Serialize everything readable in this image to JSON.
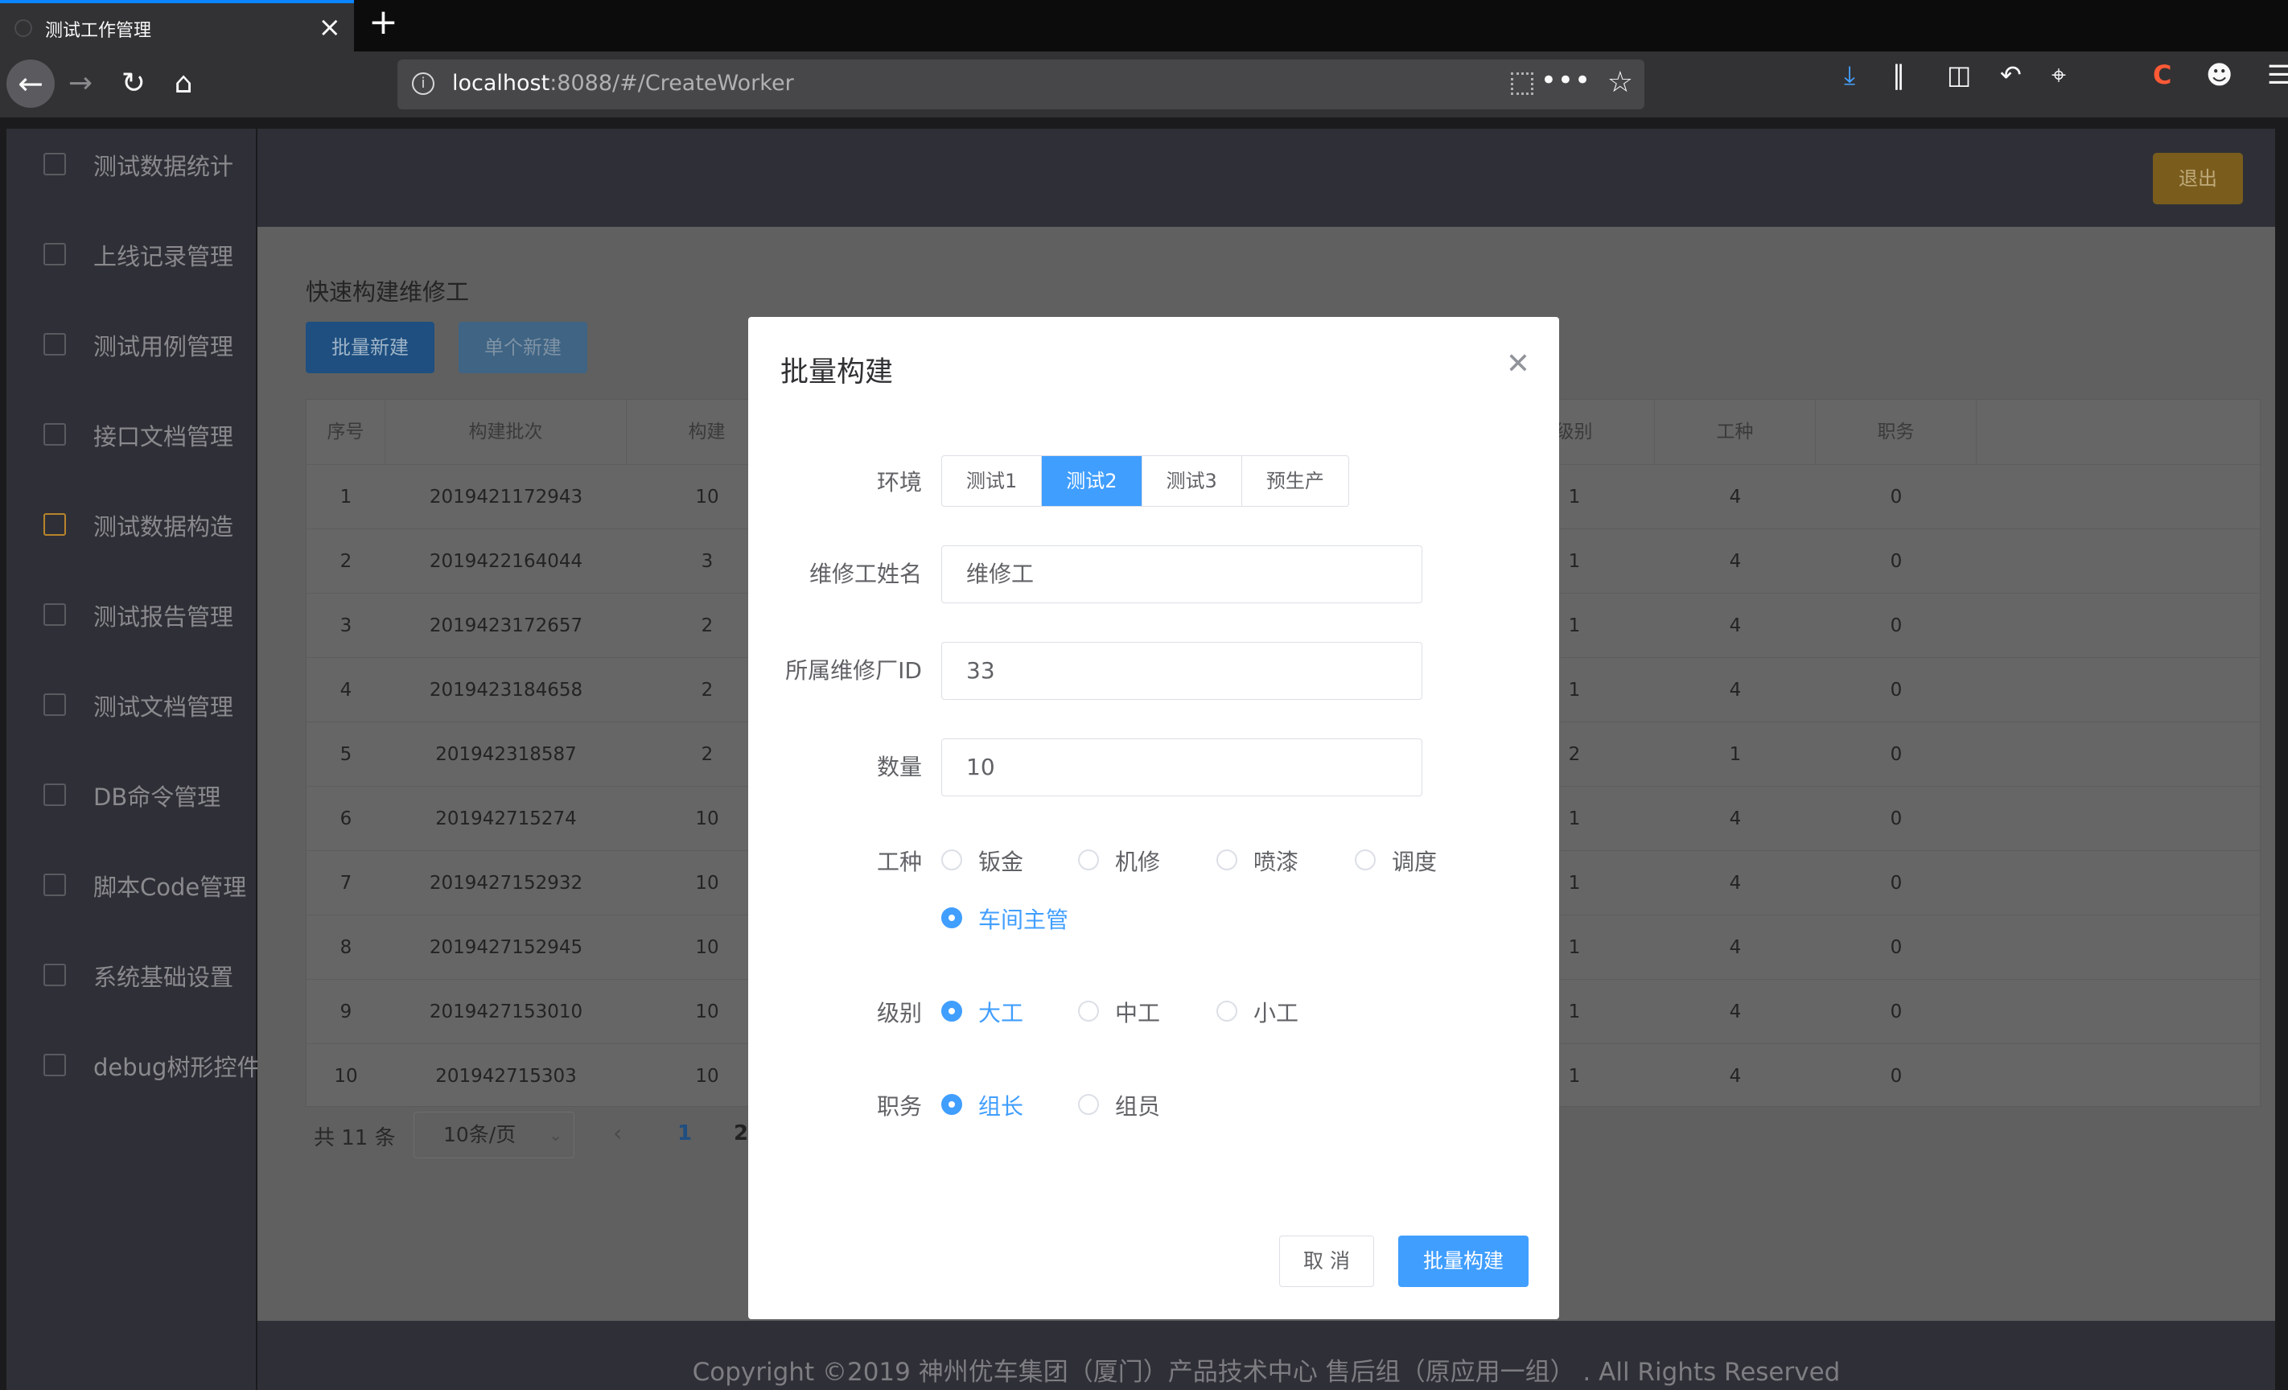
{
  "browser": {
    "tab_title": "测试工作管理",
    "tab_close_icon": "×",
    "new_tab_icon": "+",
    "url_host": "localhost",
    "url_rest": ":8088/#/CreateWorker"
  },
  "sidebar": {
    "items": [
      {
        "label": "测试数据统计",
        "icon": "bar-chart-icon"
      },
      {
        "label": "上线记录管理",
        "icon": "record-icon"
      },
      {
        "label": "测试用例管理",
        "icon": "document-icon"
      },
      {
        "label": "接口文档管理",
        "icon": "api-doc-icon"
      },
      {
        "label": "测试数据构造",
        "icon": "edit-icon"
      },
      {
        "label": "测试报告管理",
        "icon": "report-icon"
      },
      {
        "label": "测试文档管理",
        "icon": "file-check-icon"
      },
      {
        "label": "DB命令管理",
        "icon": "database-icon"
      },
      {
        "label": "脚本Code管理",
        "icon": "code-icon"
      },
      {
        "label": "系统基础设置",
        "icon": "gear-icon"
      },
      {
        "label": "debug树形控件",
        "icon": "tree-doc-icon"
      }
    ]
  },
  "header": {
    "logout_label": "退出"
  },
  "page": {
    "title": "快速构建维修工",
    "batch_new_label": "批量新建",
    "single_new_label": "单个新建"
  },
  "table": {
    "columns": {
      "seq": "序号",
      "batch": "构建批次",
      "build": "构建",
      "level": "级别",
      "type": "工种",
      "duty": "职务"
    },
    "rows": [
      {
        "seq": "1",
        "batch": "2019421172943",
        "build": "10",
        "level": "1",
        "type": "4",
        "duty": "0"
      },
      {
        "seq": "2",
        "batch": "2019422164044",
        "build": "3",
        "level": "1",
        "type": "4",
        "duty": "0"
      },
      {
        "seq": "3",
        "batch": "2019423172657",
        "build": "2",
        "level": "1",
        "type": "4",
        "duty": "0"
      },
      {
        "seq": "4",
        "batch": "2019423184658",
        "build": "2",
        "level": "1",
        "type": "4",
        "duty": "0"
      },
      {
        "seq": "5",
        "batch": "201942318587",
        "build": "2",
        "level": "2",
        "type": "1",
        "duty": "0"
      },
      {
        "seq": "6",
        "batch": "201942715274",
        "build": "10",
        "level": "1",
        "type": "4",
        "duty": "0"
      },
      {
        "seq": "7",
        "batch": "2019427152932",
        "build": "10",
        "level": "1",
        "type": "4",
        "duty": "0"
      },
      {
        "seq": "8",
        "batch": "2019427152945",
        "build": "10",
        "level": "1",
        "type": "4",
        "duty": "0"
      },
      {
        "seq": "9",
        "batch": "2019427153010",
        "build": "10",
        "level": "1",
        "type": "4",
        "duty": "0"
      },
      {
        "seq": "10",
        "batch": "201942715303",
        "build": "10",
        "level": "1",
        "type": "4",
        "duty": "0"
      }
    ]
  },
  "pagination": {
    "total": "共 11 条",
    "page_size": "10条/页",
    "page1": "1",
    "page2": "2"
  },
  "footer": {
    "text": "Copyright ©2019 神州优车集团（厦门）产品技术中心 售后组（原应用一组） . All Rights Reserved"
  },
  "modal": {
    "title": "批量构建",
    "env_label": "环境",
    "env_options": [
      "测试1",
      "测试2",
      "测试3",
      "预生产"
    ],
    "env_selected": "测试2",
    "name_label": "维修工姓名",
    "name_value": "维修工",
    "factory_label": "所属维修厂ID",
    "factory_value": "33",
    "count_label": "数量",
    "count_value": "10",
    "type_label": "工种",
    "type_options": [
      "钣金",
      "机修",
      "喷漆",
      "调度",
      "车间主管"
    ],
    "type_selected": "车间主管",
    "level_label": "级别",
    "level_options": [
      "大工",
      "中工",
      "小工"
    ],
    "level_selected": "大工",
    "duty_label": "职务",
    "duty_options": [
      "组长",
      "组员"
    ],
    "duty_selected": "组长",
    "cancel_label": "取 消",
    "confirm_label": "批量构建"
  },
  "colors": {
    "primary": "#409eff",
    "sidebar_bg": "#2f3037",
    "logout_bg": "#e6a23c"
  }
}
